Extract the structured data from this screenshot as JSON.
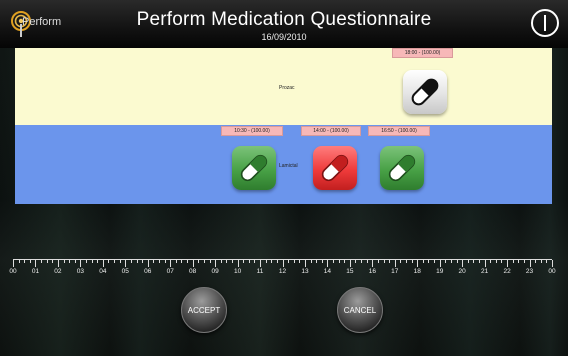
{
  "header": {
    "logo_text": "Perform",
    "title": "Perform Medication Questionnaire",
    "date": "16/09/2010",
    "power_icon": "power-icon"
  },
  "bands": [
    {
      "label": "Prozac",
      "color": "#fbfad0",
      "doses": [
        {
          "time": "18:00 - (100.00)",
          "status": "pending",
          "color": "#e0e0e0"
        }
      ]
    },
    {
      "label": "Lamictal",
      "color": "#6b95ec",
      "doses": [
        {
          "time": "10:30 - (100.00)",
          "status": "taken",
          "color": "#48a146"
        },
        {
          "time": "14:00 - (100.00)",
          "status": "missed",
          "color": "#ef3b3b"
        },
        {
          "time": "16:50 - (100.00)",
          "status": "taken",
          "color": "#48a146"
        }
      ]
    }
  ],
  "timeline": {
    "hours": [
      "00",
      "01",
      "02",
      "03",
      "04",
      "05",
      "06",
      "07",
      "08",
      "09",
      "10",
      "11",
      "12",
      "13",
      "14",
      "15",
      "16",
      "17",
      "18",
      "19",
      "20",
      "21",
      "22",
      "23",
      "00"
    ]
  },
  "actions": {
    "accept_label": "ACCEPT",
    "cancel_label": "CANCEL"
  },
  "icons": {
    "dose_icon": "pill-capsule-icon"
  }
}
